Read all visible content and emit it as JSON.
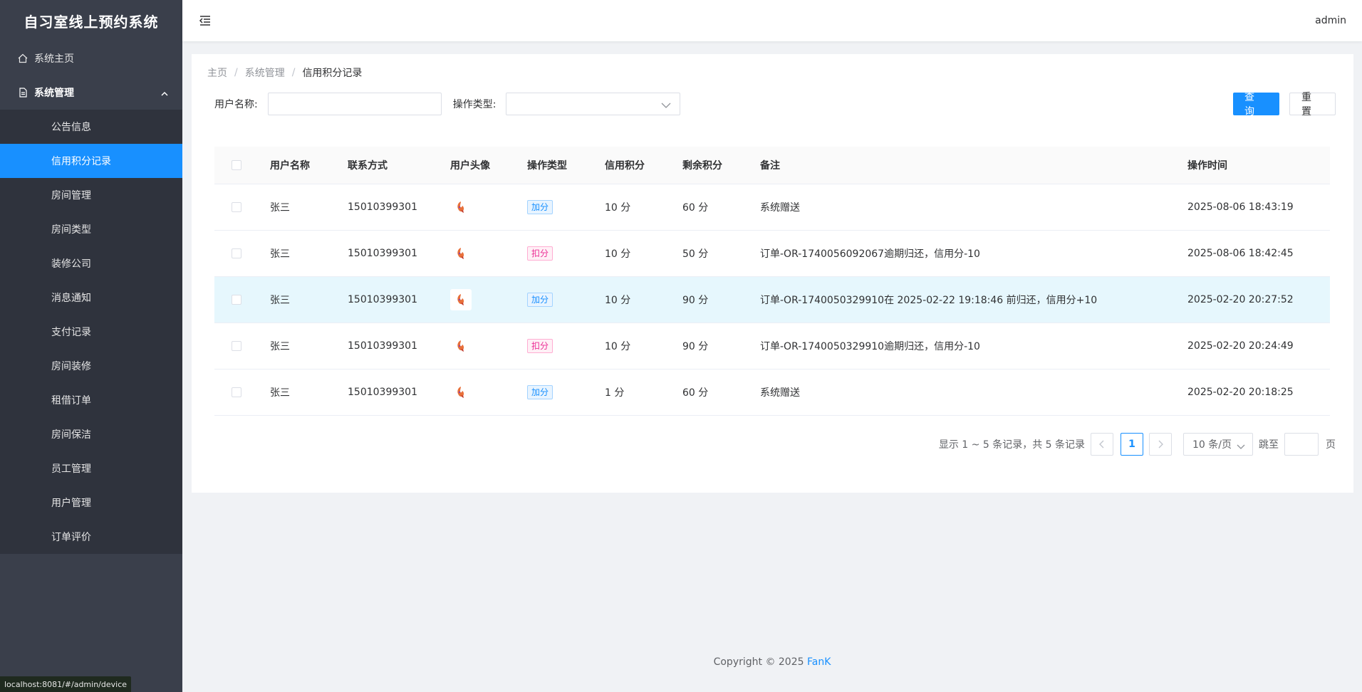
{
  "app": {
    "title": "自习室线上预约系统",
    "user": "admin"
  },
  "sidebar": {
    "home": "系统主页",
    "group": "系统管理",
    "items": [
      {
        "label": "公告信息",
        "active": false
      },
      {
        "label": "信用积分记录",
        "active": true
      },
      {
        "label": "房间管理",
        "active": false
      },
      {
        "label": "房间类型",
        "active": false
      },
      {
        "label": "装修公司",
        "active": false
      },
      {
        "label": "消息通知",
        "active": false
      },
      {
        "label": "支付记录",
        "active": false
      },
      {
        "label": "房间装修",
        "active": false
      },
      {
        "label": "租借订单",
        "active": false
      },
      {
        "label": "房间保洁",
        "active": false
      },
      {
        "label": "员工管理",
        "active": false
      },
      {
        "label": "用户管理",
        "active": false
      },
      {
        "label": "订单评价",
        "active": false
      }
    ]
  },
  "status_url": "localhost:8081/#/admin/device",
  "breadcrumb": {
    "home": "主页",
    "section": "系统管理",
    "current": "信用积分记录"
  },
  "filter": {
    "username_label": "用户名称:",
    "username_value": "",
    "type_label": "操作类型:",
    "type_value": "",
    "query_label": "查 询",
    "reset_label": "重 置"
  },
  "table": {
    "headers": [
      "用户名称",
      "联系方式",
      "用户头像",
      "操作类型",
      "信用积分",
      "剩余积分",
      "备注",
      "操作时间"
    ],
    "rows": [
      {
        "name": "张三",
        "phone": "15010399301",
        "type": "加分",
        "kind": "add",
        "score": "10 分",
        "left": "60 分",
        "remark": "系统赠送",
        "time": "2025-08-06 18:43:19"
      },
      {
        "name": "张三",
        "phone": "15010399301",
        "type": "扣分",
        "kind": "sub",
        "score": "10 分",
        "left": "50 分",
        "remark": "订单-OR-1740056092067逾期归还，信用分-10",
        "time": "2025-08-06 18:42:45"
      },
      {
        "name": "张三",
        "phone": "15010399301",
        "type": "加分",
        "kind": "add",
        "score": "10 分",
        "left": "90 分",
        "remark": "订单-OR-1740050329910在 2025-02-22 19:18:46 前归还，信用分+10",
        "time": "2025-02-20 20:27:52"
      },
      {
        "name": "张三",
        "phone": "15010399301",
        "type": "扣分",
        "kind": "sub",
        "score": "10 分",
        "left": "90 分",
        "remark": "订单-OR-1740050329910逾期归还，信用分-10",
        "time": "2025-02-20 20:24:49"
      },
      {
        "name": "张三",
        "phone": "15010399301",
        "type": "加分",
        "kind": "add",
        "score": "1 分",
        "left": "60 分",
        "remark": "系统赠送",
        "time": "2025-02-20 20:18:25"
      }
    ]
  },
  "pager": {
    "summary": "显示 1 ~ 5 条记录，共 5 条记录",
    "page": "1",
    "size": "10 条/页",
    "jump_label": "跳至",
    "page_unit": "页"
  },
  "footer": {
    "text": "Copyright © 2025",
    "author": "FanK"
  },
  "colors": {
    "accent": "#1890ff",
    "sidebar_bg": "#3a3f4b",
    "submenu_bg": "#2f333d"
  }
}
